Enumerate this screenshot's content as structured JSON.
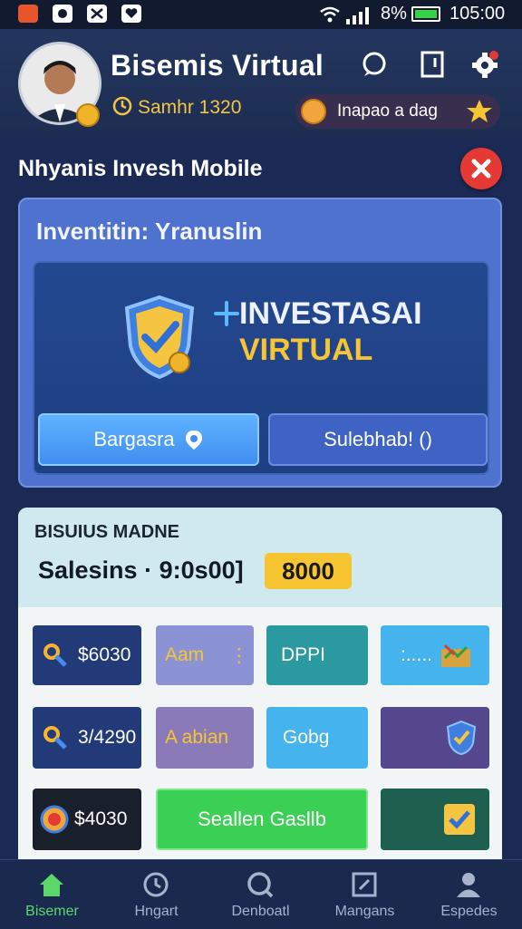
{
  "status_bar": {
    "battery": "8%",
    "time": "105:00"
  },
  "header": {
    "title": "Bisemis Virtual",
    "coins": "Samhr 1320",
    "promo_text": "Inapao a dag"
  },
  "section": {
    "title": "Nhyanis Invesh Mobile"
  },
  "invest_card": {
    "heading": "Inventitin: Yranuslin",
    "banner_line1": "INVESTASAI",
    "banner_line2": "VIRTUAL",
    "button_primary": "Bargasra",
    "button_secondary": "Sulebhab! ()"
  },
  "business": {
    "title": "BISUIUS MADNE",
    "sales_label": "Salesins · 9:0s00]",
    "sales_value": "8000",
    "tiles": [
      {
        "label": "$6030",
        "icon": "key-icon",
        "color": "#223a78"
      },
      {
        "label": "Aam",
        "icon": "dots-icon",
        "color": "#8b93d4"
      },
      {
        "label": "DPPI",
        "icon": "",
        "color": "#2b9aa0"
      },
      {
        "label": ":.....",
        "icon": "chart-card-icon",
        "color": "#45b4ee"
      },
      {
        "label": "3/4290",
        "icon": "key-icon",
        "color": "#223a78"
      },
      {
        "label": "A abian",
        "icon": "",
        "color": "#8b7ab8"
      },
      {
        "label": "Gobg",
        "icon": "",
        "color": "#45b4ee"
      },
      {
        "label": "",
        "icon": "shield-icon",
        "color": "#54478e"
      },
      {
        "label": "$4030",
        "icon": "coin-icon",
        "color": "#1a1f2c"
      },
      {
        "label": "Seallen Gasllb",
        "icon": "",
        "color": "#3ccf56"
      },
      {
        "label": "",
        "icon": "check-icon",
        "color": "#1e5f50"
      }
    ]
  },
  "nav": [
    {
      "label": "Bisemer",
      "icon": "home-icon",
      "active": true
    },
    {
      "label": "Hngart",
      "icon": "time-icon",
      "active": false
    },
    {
      "label": "Denboatl",
      "icon": "search-icon",
      "active": false
    },
    {
      "label": "Mangans",
      "icon": "edit-icon",
      "active": false
    },
    {
      "label": "Espedes",
      "icon": "profile-icon",
      "active": false
    }
  ],
  "colors": {
    "accent_green": "#5cd86a",
    "gold": "#f7c531",
    "alert_red": "#e53935"
  }
}
